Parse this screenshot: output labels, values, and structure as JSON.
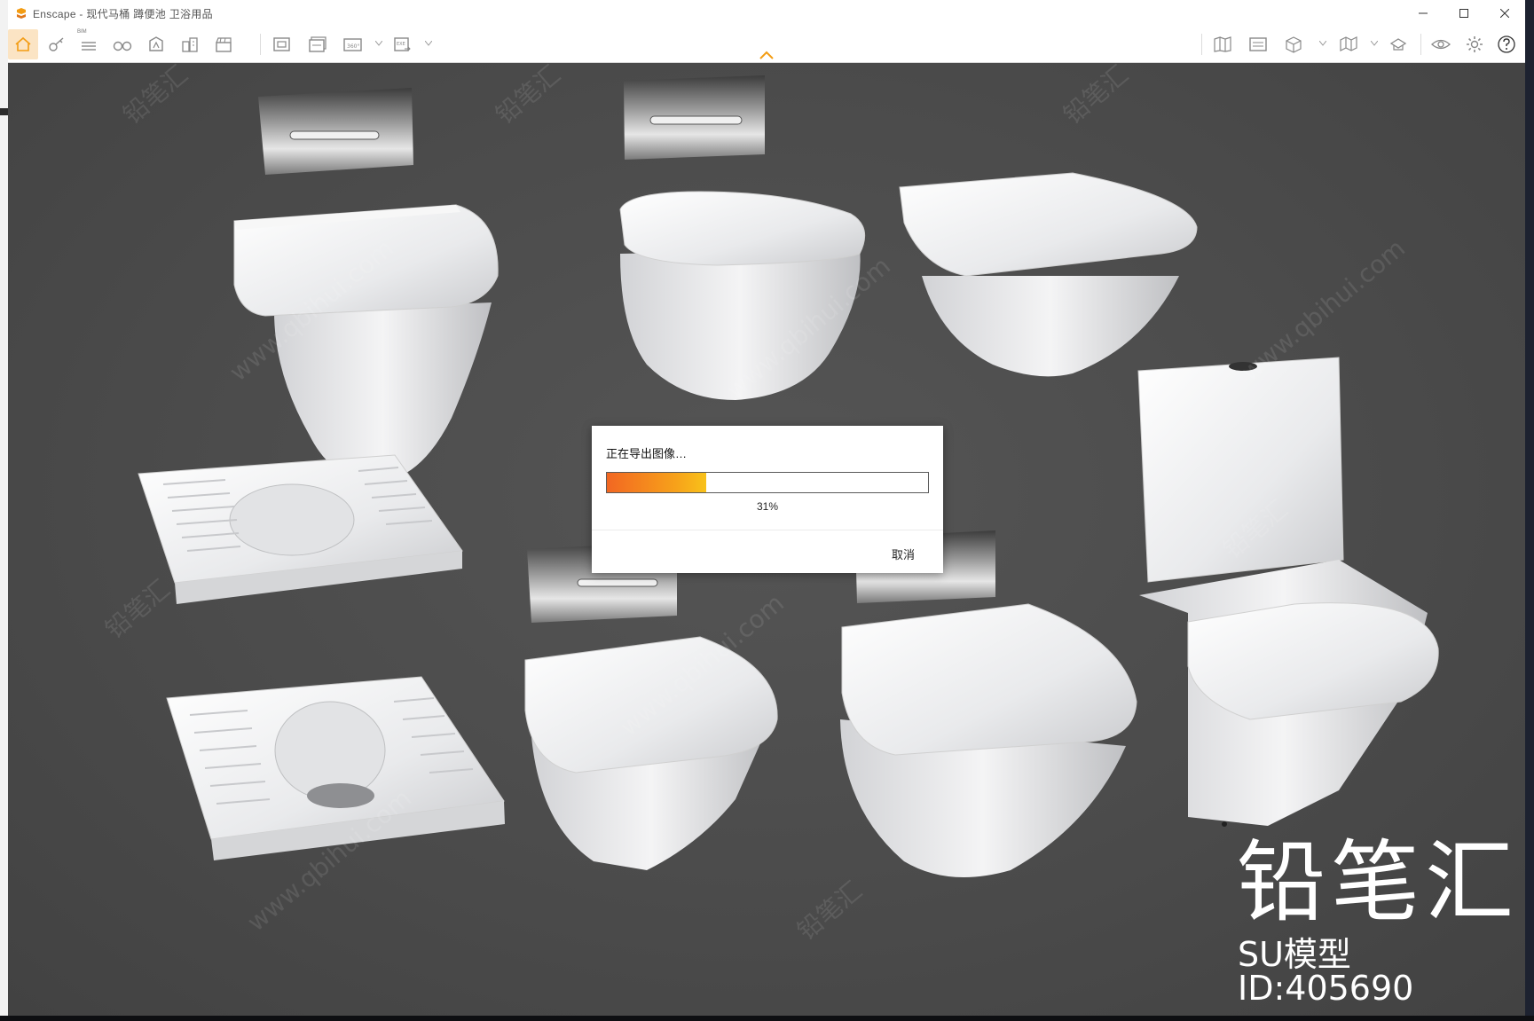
{
  "window": {
    "title": "Enscape - 现代马桶 蹲便池 卫浴用品"
  },
  "toolbar": {
    "bim_label": "BIM",
    "icons": [
      "home-icon",
      "key-icon",
      "bim-list-icon",
      "binoculars-icon",
      "vr-icon",
      "buildings-icon",
      "clapper-icon",
      "screenshot-icon",
      "batch-render-icon",
      "panorama-360-icon",
      "export-exe-icon",
      "asset-library-icon",
      "materials-icon",
      "cube-view-icon",
      "map-icon",
      "settings-hat-icon",
      "eye-icon",
      "gear-icon",
      "help-icon"
    ]
  },
  "dialog": {
    "title": "正在导出图像…",
    "progress": 31,
    "progress_text": "31%",
    "cancel_label": "取消"
  },
  "watermark": {
    "brand": "铅笔汇",
    "model_id": "SU模型ID:405690",
    "tiled_text_a": "www.qbihui.com",
    "tiled_text_b": "铅笔汇"
  },
  "colors": {
    "accent": "#f39c12",
    "progress_start": "#f26722",
    "progress_end": "#f8c21a",
    "viewport_bg": "#4a4a4a"
  }
}
